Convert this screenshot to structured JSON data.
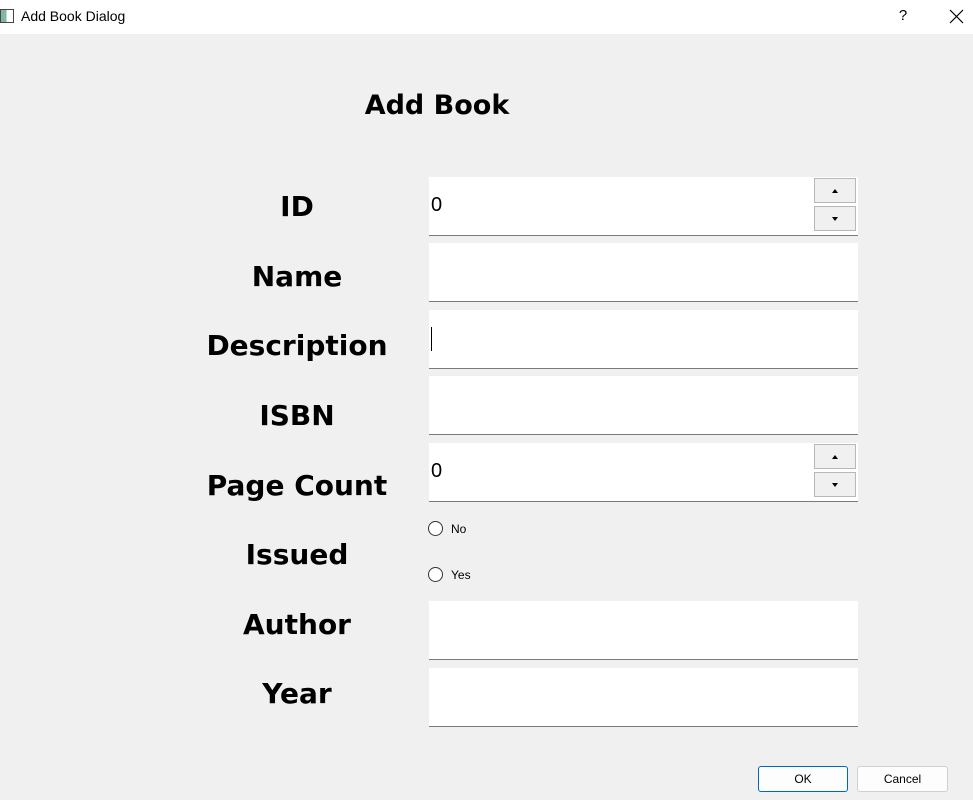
{
  "window": {
    "title": "Add Book Dialog",
    "help_label": "?",
    "icons": {
      "app": "app-window-icon",
      "close": "close-icon"
    }
  },
  "form": {
    "heading": "Add Book",
    "id": {
      "label": "ID",
      "value": "0"
    },
    "name": {
      "label": "Name",
      "value": ""
    },
    "description": {
      "label": "Description",
      "value": ""
    },
    "isbn": {
      "label": "ISBN",
      "value": ""
    },
    "page_count": {
      "label": "Page Count",
      "value": "0"
    },
    "issued": {
      "label": "Issued",
      "options": [
        "No",
        "Yes"
      ],
      "selected": null
    },
    "author": {
      "label": "Author",
      "value": ""
    },
    "year": {
      "label": "Year",
      "value": ""
    }
  },
  "buttons": {
    "ok": "OK",
    "cancel": "Cancel"
  }
}
